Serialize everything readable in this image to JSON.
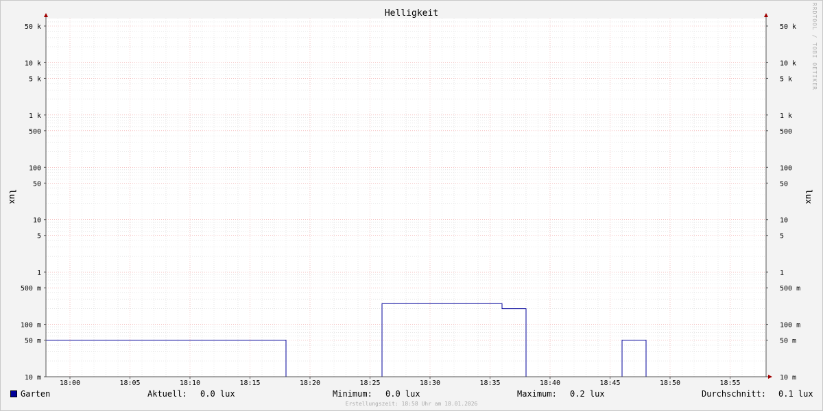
{
  "chart_data": {
    "type": "line",
    "title": "Helligkeit",
    "ylabel": "lux",
    "yscale": "log",
    "ylim": [
      10,
      70000
    ],
    "xlim": [
      "17:58",
      "18:58"
    ],
    "grid": true,
    "y_ticks": [
      {
        "value": 50000,
        "label": "50 k"
      },
      {
        "value": 10000,
        "label": "10 k"
      },
      {
        "value": 5000,
        "label": "5 k"
      },
      {
        "value": 1000,
        "label": "1 k"
      },
      {
        "value": 500,
        "label": "500"
      },
      {
        "value": 100,
        "label": "100"
      },
      {
        "value": 50,
        "label": "50"
      },
      {
        "value": 10,
        "label": "10"
      },
      {
        "value": 5,
        "label": "5"
      },
      {
        "value": 1,
        "label": "1"
      },
      {
        "value": 0.5,
        "label": "500 m"
      },
      {
        "value": 0.1,
        "label": "100 m"
      },
      {
        "value": 0.05,
        "label": "50 m"
      },
      {
        "value": 0.01,
        "label": "10 m"
      }
    ],
    "x_ticks": [
      "18:00",
      "18:05",
      "18:10",
      "18:15",
      "18:20",
      "18:25",
      "18:30",
      "18:35",
      "18:40",
      "18:45",
      "18:50",
      "18:55"
    ],
    "series": [
      {
        "name": "Garten",
        "color": "#000099",
        "points": [
          {
            "x": "17:58",
            "y": 0.05
          },
          {
            "x": "18:18",
            "y": 0.05
          },
          {
            "x": "18:18",
            "y": 0.01
          },
          {
            "x": "18:26",
            "y": 0.01
          },
          {
            "x": "18:26",
            "y": 0.25
          },
          {
            "x": "18:36",
            "y": 0.25
          },
          {
            "x": "18:36",
            "y": 0.2
          },
          {
            "x": "18:38",
            "y": 0.2
          },
          {
            "x": "18:38",
            "y": 0.01
          },
          {
            "x": "18:46",
            "y": 0.01
          },
          {
            "x": "18:46",
            "y": 0.05
          },
          {
            "x": "18:48",
            "y": 0.05
          },
          {
            "x": "18:48",
            "y": 0.01
          },
          {
            "x": "18:58",
            "y": 0.01
          }
        ]
      }
    ],
    "legend_position": "bottom"
  },
  "legend": {
    "series_name": "Garten",
    "series_color": "#000099",
    "current_label": "Aktuell:",
    "current_value": "0.0 lux",
    "min_label": "Minimum:",
    "min_value": "0.0 lux",
    "max_label": "Maximum:",
    "max_value": "0.2 lux",
    "avg_label": "Durchschnitt:",
    "avg_value": "0.1 lux"
  },
  "footer": "Erstellungszeit: 18:58 Uhr am 18.01.2026",
  "credit": "RRDTOOL / TOBI OETIKER"
}
